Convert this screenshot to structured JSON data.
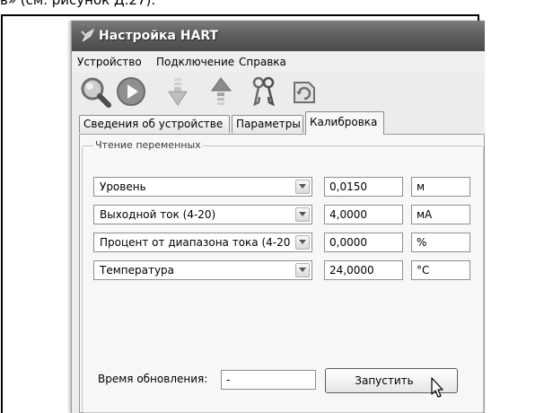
{
  "document": {
    "caption_fragment": "в» (см. рисунок Д.27)."
  },
  "window": {
    "title": "Настройка HART"
  },
  "menu": {
    "items": [
      "Устройство",
      "Подключение",
      "Справка"
    ]
  },
  "toolbar": {
    "icons": [
      "search-icon",
      "play-icon",
      "download-arrow-icon",
      "upload-arrow-icon",
      "keys-icon",
      "refresh-icon"
    ]
  },
  "tabs": {
    "items": [
      "Сведения об устройстве",
      "Параметры",
      "Калибровка"
    ],
    "active": "Калибровка"
  },
  "group": {
    "title": "Чтение переменных"
  },
  "variables": [
    {
      "name": "Уровень",
      "value": "0,0150",
      "unit": "м"
    },
    {
      "name": "Выходной ток (4-20)",
      "value": "4,0000",
      "unit": "мА"
    },
    {
      "name": "Процент от диапазона тока (4-20",
      "value": "0,0000",
      "unit": "%"
    },
    {
      "name": "Температура",
      "value": "24,0000",
      "unit": "°С"
    }
  ],
  "refresh": {
    "label": "Время обновления:",
    "value": "-"
  },
  "run_button": {
    "label": "Запустить"
  },
  "colors": {
    "titlebar": "#5f5f5f",
    "window_bg": "#ececec",
    "panel_bg": "#f7f7f7"
  }
}
